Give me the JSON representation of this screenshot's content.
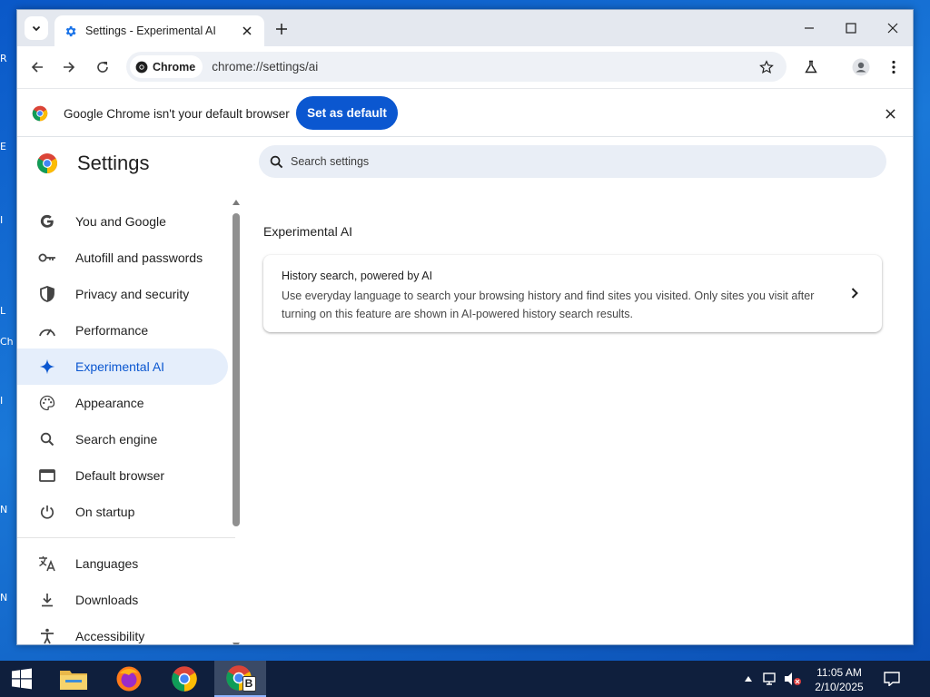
{
  "desktop": {
    "fragments": [
      "R",
      "E",
      "I",
      "L",
      "Ch",
      "I",
      "N",
      "N"
    ]
  },
  "browser": {
    "tab": {
      "title": "Settings - Experimental AI"
    },
    "new_tab_label": "+",
    "omnibox": {
      "chip_label": "Chrome",
      "url": "chrome://settings/ai"
    },
    "infobar": {
      "message": "Google Chrome isn't your default browser",
      "button_label": "Set as default"
    }
  },
  "settings": {
    "title": "Settings",
    "search": {
      "placeholder": "Search settings"
    },
    "nav": [
      {
        "label": "You and Google",
        "icon": "google-icon",
        "active": false
      },
      {
        "label": "Autofill and passwords",
        "icon": "key-icon",
        "active": false
      },
      {
        "label": "Privacy and security",
        "icon": "shield-icon",
        "active": false
      },
      {
        "label": "Performance",
        "icon": "speedometer-icon",
        "active": false
      },
      {
        "label": "Experimental AI",
        "icon": "sparkle-icon",
        "active": true
      },
      {
        "label": "Appearance",
        "icon": "palette-icon",
        "active": false
      },
      {
        "label": "Search engine",
        "icon": "search-icon",
        "active": false
      },
      {
        "label": "Default browser",
        "icon": "browser-window-icon",
        "active": false
      },
      {
        "label": "On startup",
        "icon": "power-icon",
        "active": false
      },
      {
        "label": "Languages",
        "icon": "translate-icon",
        "active": false
      },
      {
        "label": "Downloads",
        "icon": "download-icon",
        "active": false
      },
      {
        "label": "Accessibility",
        "icon": "accessibility-icon",
        "active": false
      }
    ],
    "section_title": "Experimental AI",
    "card": {
      "title": "History search, powered by AI",
      "description": "Use everyday language to search your browsing history and find sites you visited. Only sites you visit after turning on this feature are shown in AI-powered history search results."
    }
  },
  "taskbar": {
    "clock_time": "11:05 AM",
    "clock_date": "2/10/2025",
    "badge_letter": "B"
  },
  "colors": {
    "accent": "#0b57d0",
    "active_nav_bg": "#e5eefb",
    "omnibox_bg": "#eef1f6",
    "search_bg": "#e9eef6",
    "taskbar_bg": "#0f1f3d"
  }
}
